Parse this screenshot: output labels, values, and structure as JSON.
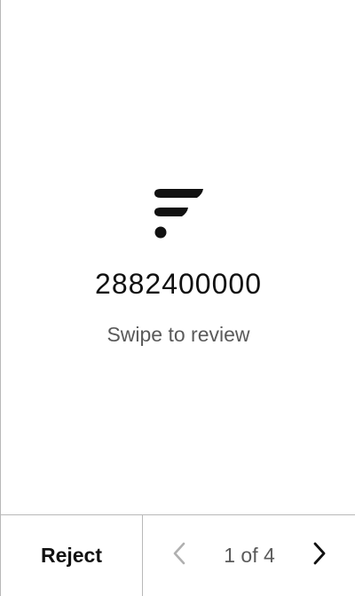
{
  "review_card": {
    "logo_icon": "brand-f-logo-icon",
    "amount": "2882400000",
    "hint": "Swipe to review"
  },
  "footer": {
    "reject_label": "Reject",
    "pagination": {
      "current": 1,
      "total": 4,
      "label": "1 of 4",
      "prev_icon": "chevron-left-icon",
      "next_icon": "chevron-right-icon",
      "prev_enabled": false,
      "next_enabled": true
    }
  },
  "colors": {
    "text_primary": "#111111",
    "text_secondary": "#5a5a5a",
    "divider": "#b8b8b8",
    "chevron_disabled": "#b0b0b0",
    "background": "#ffffff"
  }
}
